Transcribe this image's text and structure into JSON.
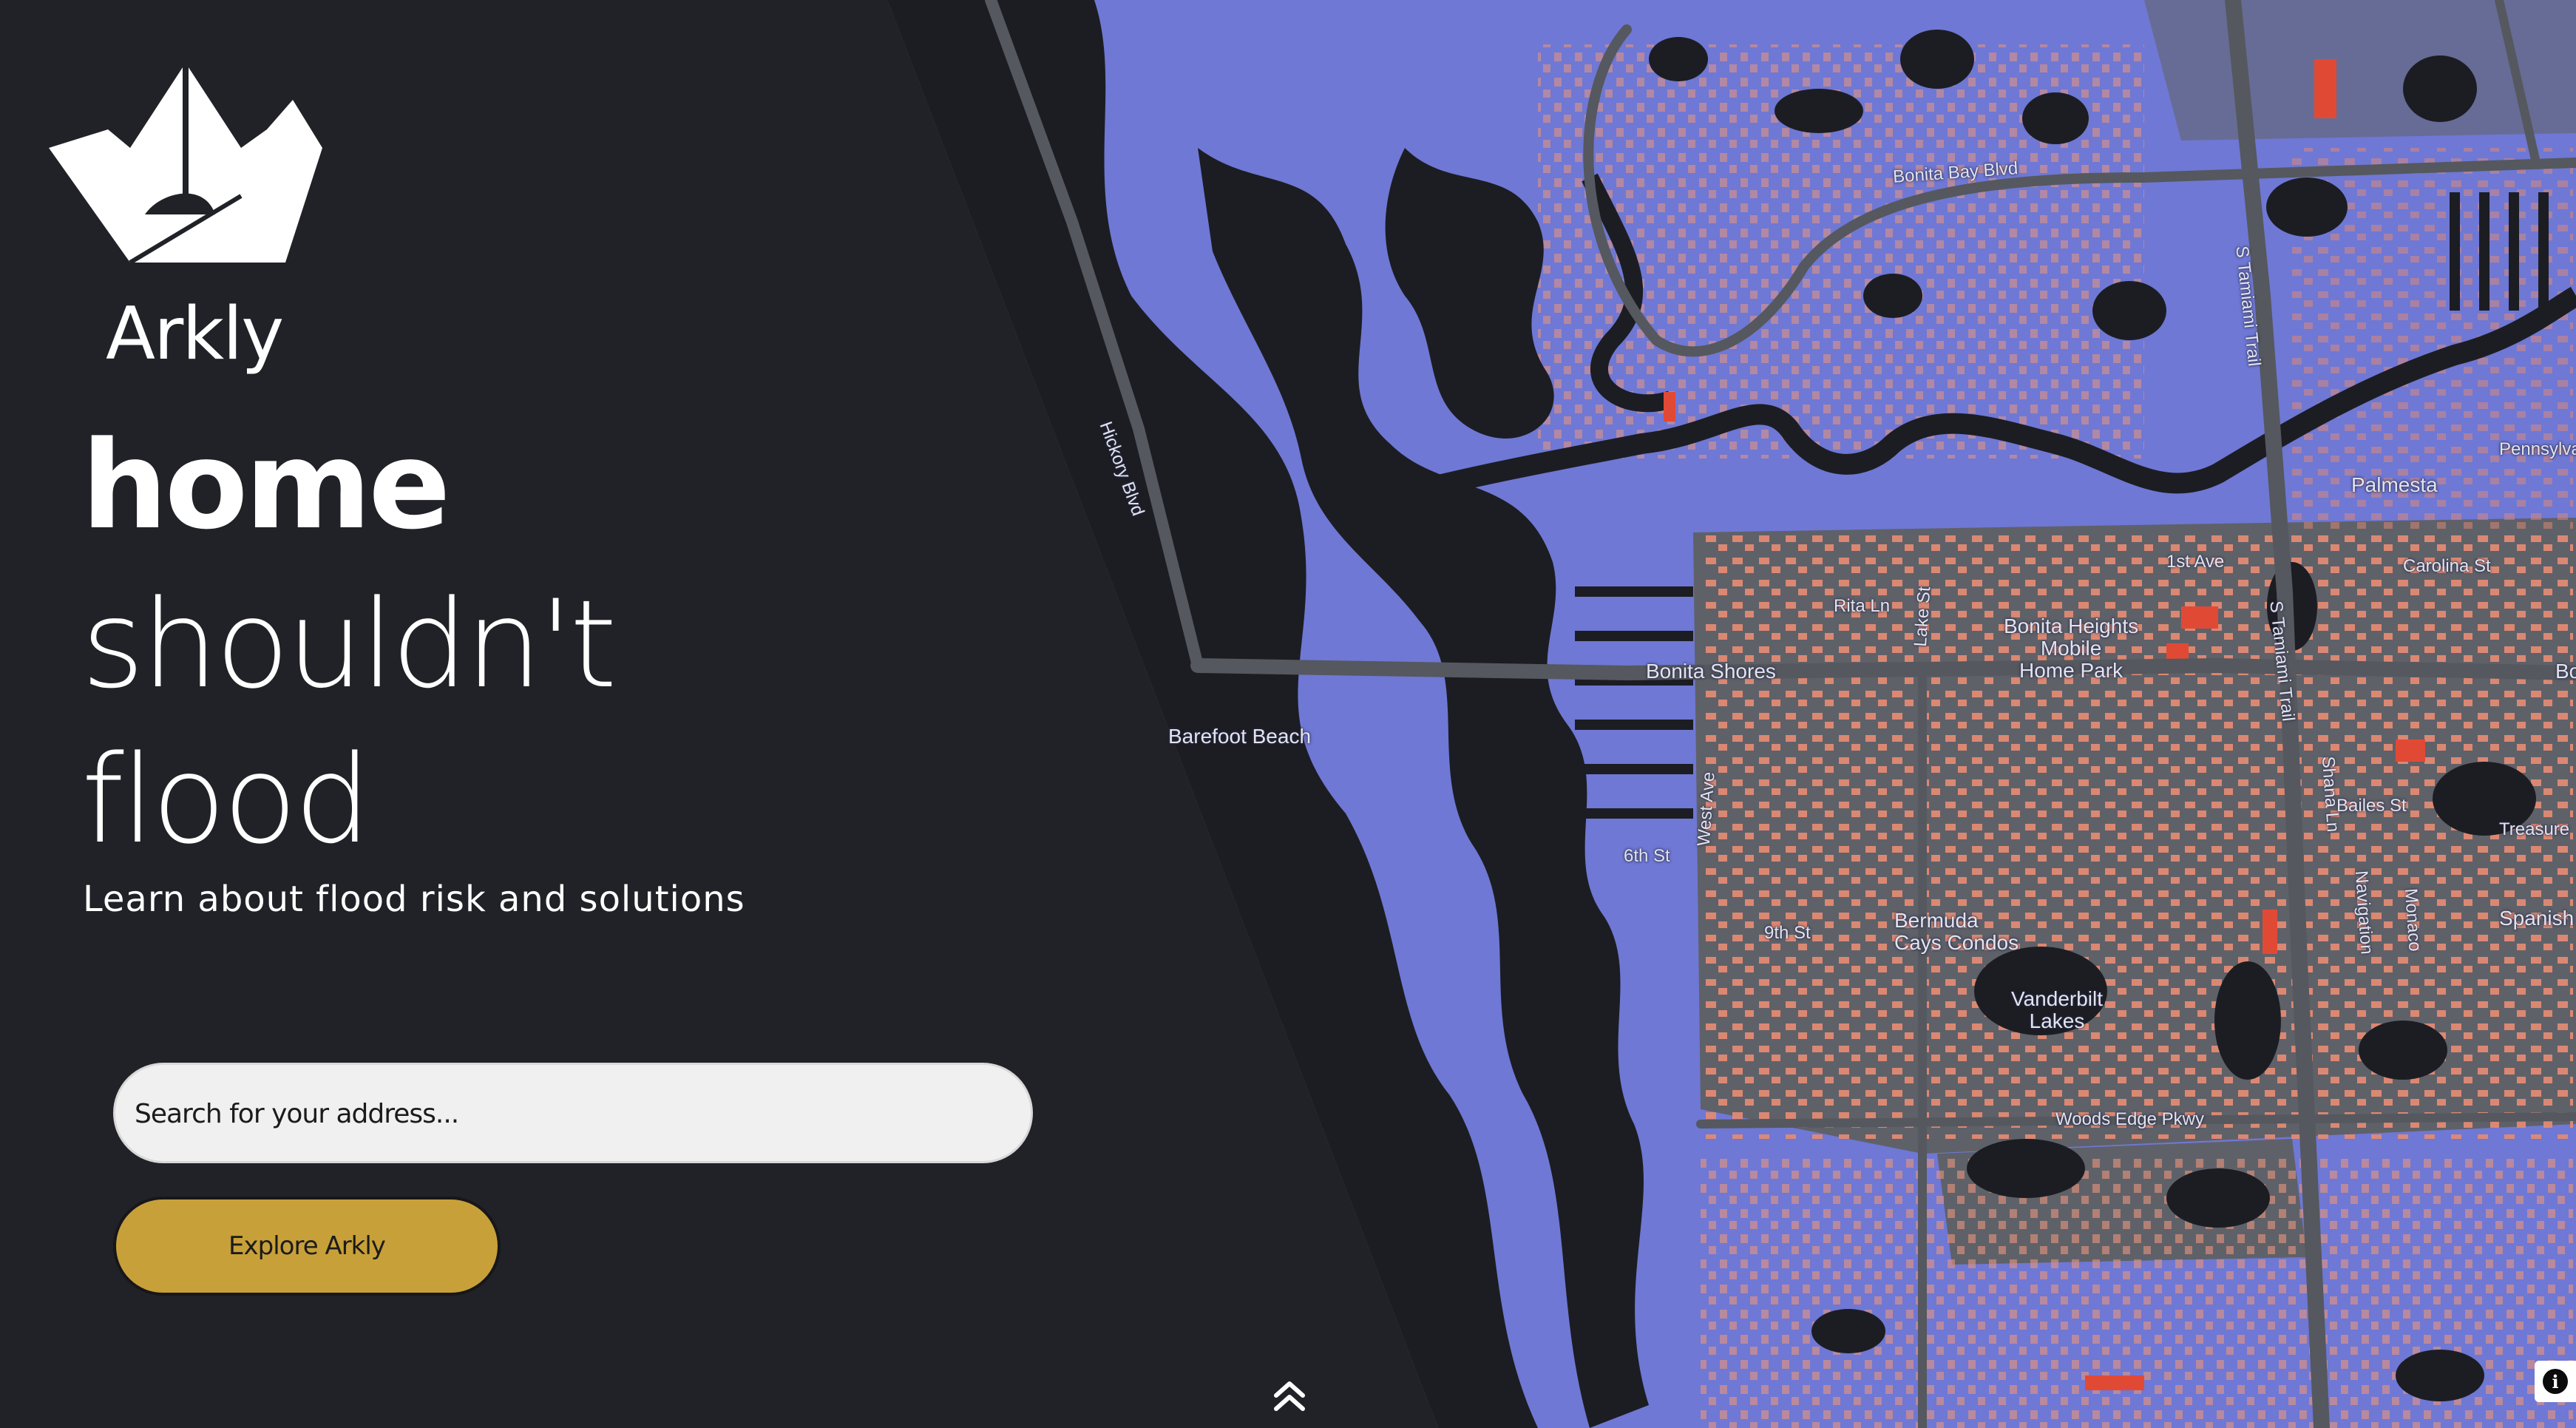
{
  "brand": {
    "name": "Arkly"
  },
  "hero": {
    "headline_lines": [
      "home",
      "shouldn't",
      "flood"
    ],
    "tagline": "Learn about flood risk and solutions"
  },
  "search": {
    "placeholder": "Search for your address..."
  },
  "cta": {
    "explore_label": "Explore Arkly"
  },
  "map": {
    "labels": {
      "bonita_bay_blvd": "Bonita Bay Blvd",
      "s_tamiami_trail_north": "S Tamiami Trail",
      "s_tamiami_trail_south": "S Tamiami Trail",
      "hickory_blvd": "Hickory Blvd",
      "pennsylvania": "Pennsylvan",
      "palmesta": "Palmesta",
      "carolina_st": "Carolina St",
      "first_ave": "1st Ave",
      "rita_ln": "Rita Ln",
      "lake_st": "Lake St",
      "bonita_heights": "Bonita Heights\nMobile\nHome Park",
      "bonita_shores": "Bonita Shores",
      "barefoot_beach": "Barefoot Beach",
      "bo": "Bo",
      "west_ave": "West Ave",
      "sixth_st": "6th St",
      "ninth_st": "9th St",
      "bermuda_cays": "Bermuda\nCays Condos",
      "vanderbilt_lakes": "Vanderbilt\nLakes",
      "woods_edge_pkwy": "Woods Edge Pkwy",
      "bailes_st": "Bailes St",
      "shana_ln": "Shana Ln",
      "treasure": "Treasure",
      "spanish": "Spanish",
      "navigation": "Navigation",
      "monaco": "Monaco"
    },
    "colors": {
      "flood": "#6f78d4",
      "water": "#1c1d23",
      "land": "#60626a",
      "road": "#55585e",
      "building": "#e28a73",
      "building_red": "#e04a35"
    }
  },
  "panel": {
    "background": "#212227",
    "accent": "#c8a03a"
  },
  "icons": {
    "logo": "paper-boat-logo",
    "scroll": "double-chevron-up-icon",
    "info": "info-icon"
  }
}
